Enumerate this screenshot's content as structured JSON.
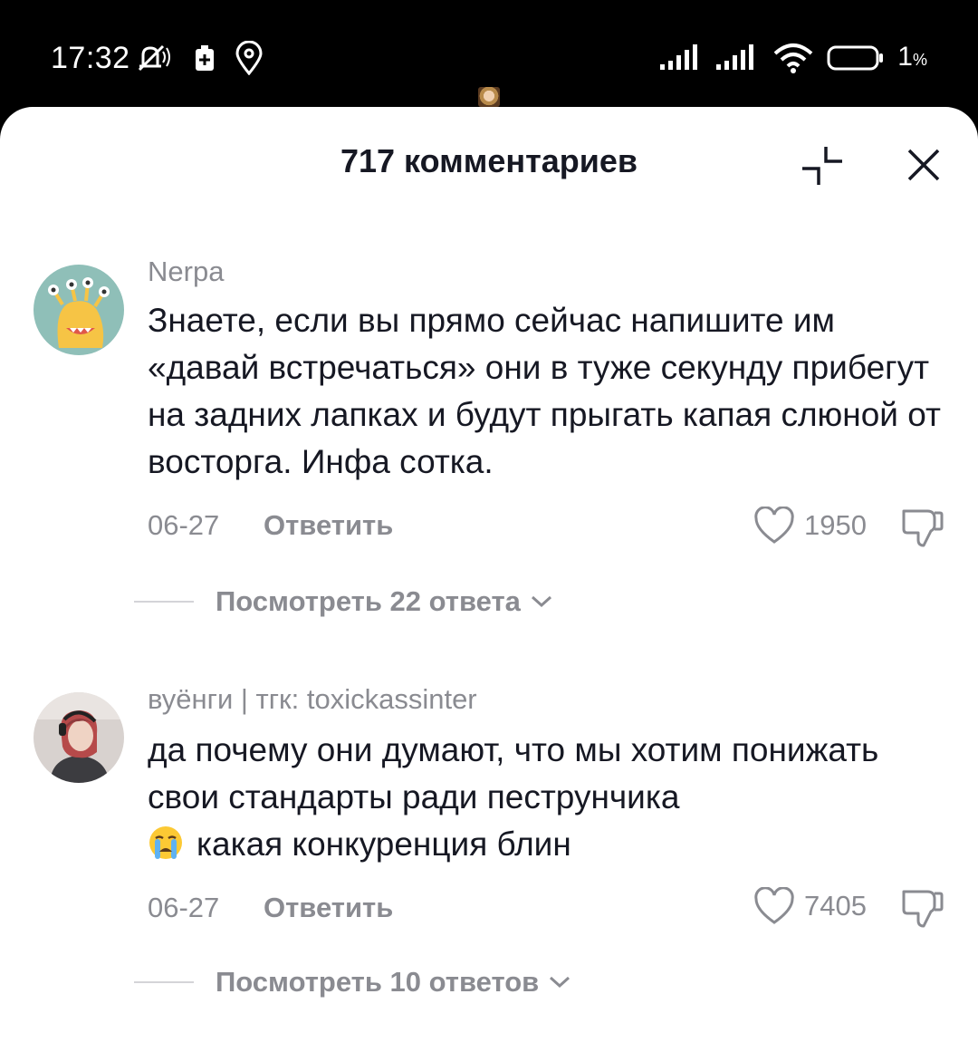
{
  "status_bar": {
    "time": "17:32",
    "battery_percent": "1",
    "battery_unit": "%",
    "icons": [
      "mute-icon",
      "battery-saver-icon",
      "location-icon",
      "signal-icon",
      "signal-icon",
      "wifi-icon",
      "battery-icon"
    ]
  },
  "sheet": {
    "title": "717 комментариев",
    "collapse_icon": "collapse-icon",
    "close_icon": "close-icon"
  },
  "comments": [
    {
      "username": "Nerpa",
      "text": "Знаете, если вы прямо сейчас напишите им «давай встречаться» они в туже секунду прибегут на задних лапках и будут прыгать капая слюной от восторга. Инфа сотка.",
      "date": "06-27",
      "reply_label": "Ответить",
      "likes": "1950",
      "view_replies": "Посмотреть 22 ответа"
    },
    {
      "username": "вуёнги | тгк: toxickassinter",
      "emoji": "crying-face",
      "text": "да почему они думают, что мы хотим понижать свои стандарты ради пеструнчика",
      "text_tail": "какая конкуренция блин",
      "date": "06-27",
      "reply_label": "Ответить",
      "likes": "7405",
      "view_replies": "Посмотреть 10 ответов"
    }
  ],
  "colors": {
    "text_primary": "#161823",
    "text_secondary": "#8a8b91",
    "sheet_bg": "#ffffff",
    "status_bg": "#000000"
  }
}
